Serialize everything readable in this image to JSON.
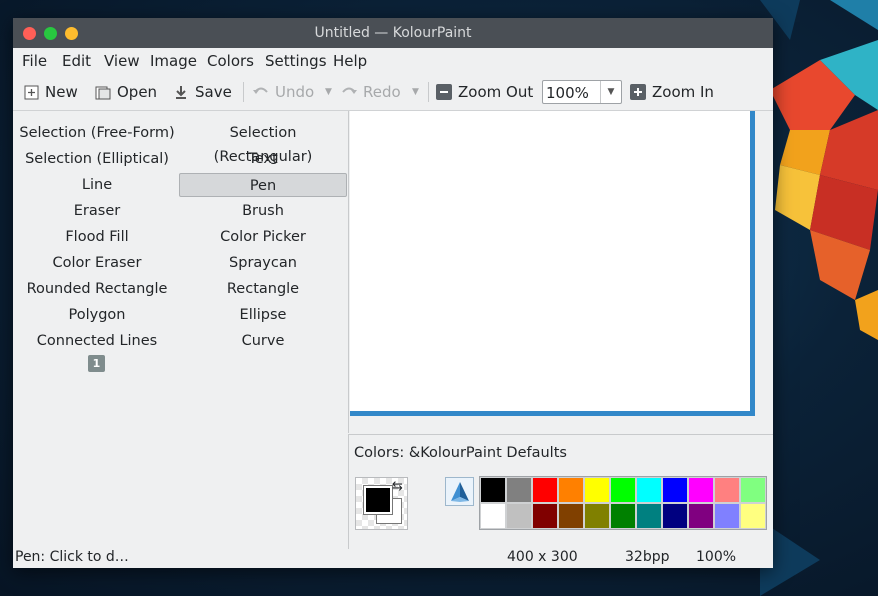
{
  "window": {
    "title": "Untitled — KolourPaint"
  },
  "menu": [
    {
      "label": "File"
    },
    {
      "label": "Edit"
    },
    {
      "label": "View"
    },
    {
      "label": "Image"
    },
    {
      "label": "Colors"
    },
    {
      "label": "Settings"
    },
    {
      "label": "Help"
    }
  ],
  "toolbar": {
    "new_label": "New",
    "open_label": "Open",
    "save_label": "Save",
    "undo_label": "Undo",
    "redo_label": "Redo",
    "zoom_out_label": "Zoom Out",
    "zoom_value": "100%",
    "zoom_in_label": "Zoom In"
  },
  "tools": [
    {
      "label": "Selection (Free-Form)",
      "active": false
    },
    {
      "label": "Selection (Rectangular)",
      "active": false
    },
    {
      "label": "Selection (Elliptical)",
      "active": false
    },
    {
      "label": "Text",
      "active": false
    },
    {
      "label": "Line",
      "active": false
    },
    {
      "label": "Pen",
      "active": true
    },
    {
      "label": "Eraser",
      "active": false
    },
    {
      "label": "Brush",
      "active": false
    },
    {
      "label": "Flood Fill",
      "active": false
    },
    {
      "label": "Color Picker",
      "active": false
    },
    {
      "label": "Color Eraser",
      "active": false
    },
    {
      "label": "Spraycan",
      "active": false
    },
    {
      "label": "Rounded Rectangle",
      "active": false
    },
    {
      "label": "Rectangle",
      "active": false
    },
    {
      "label": "Polygon",
      "active": false
    },
    {
      "label": "Ellipse",
      "active": false
    },
    {
      "label": "Connected Lines",
      "active": false
    },
    {
      "label": "Curve",
      "active": false
    }
  ],
  "tool_option_badge": "1",
  "colors": {
    "label": "Colors: &KolourPaint Defaults",
    "foreground": "#000000",
    "background": "#ffffff",
    "palette_row1": [
      "#000000",
      "#808080",
      "#ff0000",
      "#ff8000",
      "#ffff00",
      "#00ff00",
      "#00ffff",
      "#0000ff",
      "#ff00ff",
      "#ff8080",
      "#80ff80"
    ],
    "palette_row2": [
      "#ffffff",
      "#c0c0c0",
      "#800000",
      "#804000",
      "#808000",
      "#008000",
      "#008080",
      "#000080",
      "#800080",
      "#8080ff",
      "#ffff80"
    ]
  },
  "status": {
    "message": "Pen: Click to d…",
    "size": "400 x 300",
    "depth": "32bpp",
    "zoom": "100%"
  },
  "accent_color": "#3288c9"
}
